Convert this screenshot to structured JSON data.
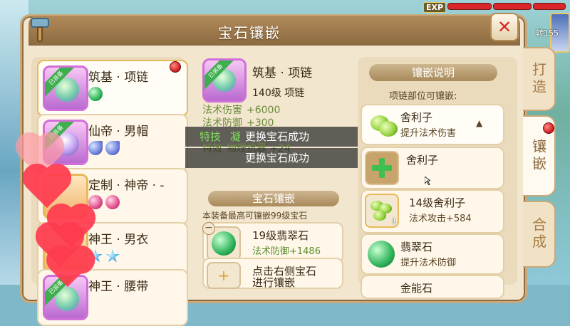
{
  "window": {
    "title": "宝石镶嵌"
  },
  "hud": {
    "exp_label": "EXP",
    "level_tag": "转155"
  },
  "tabs": [
    {
      "label": "打造"
    },
    {
      "label": "镶嵌"
    },
    {
      "label": "合成"
    }
  ],
  "equipment_list": [
    {
      "badge": "已装备",
      "name": "筑基 · 项链",
      "gems": [
        "green"
      ]
    },
    {
      "badge": "已装备",
      "name": "仙帝 · 男帽",
      "gems": [
        "moon",
        "moon"
      ]
    },
    {
      "badge": "",
      "name": "定制 · 神帝 · -",
      "gems": [
        "pink",
        "pink"
      ]
    },
    {
      "badge": "",
      "name": "神王 · 男衣",
      "gems": [
        "blue",
        "blue"
      ]
    },
    {
      "badge": "已装备",
      "name": "神王 · 腰带",
      "gems": []
    }
  ],
  "selected_item": {
    "badge": "已装备",
    "name": "筑基 · 项链",
    "level_line": "140级 项链",
    "attrs": [
      {
        "name": "法术伤害",
        "value": "+6000"
      },
      {
        "name": "法术防御",
        "value": "+300"
      },
      {
        "name": "特技",
        "value": "凝"
      },
      {
        "name": "特效",
        "value": "物理抗暴 +24"
      }
    ]
  },
  "toasts": [
    "更换宝石成功",
    "更换宝石成功"
  ],
  "socket_section": {
    "header": "宝石镶嵌",
    "note": "本装备最高可镶嵌99级宝石",
    "slots": [
      {
        "name": "19级翡翠石",
        "attr": "法术防御+1486"
      },
      {
        "name": "点击右侧宝石",
        "attr": "进行镶嵌"
      }
    ]
  },
  "inlay_info": {
    "header": "镶嵌说明",
    "note": "项链部位可镶嵌:",
    "gems": [
      {
        "name": "舍利子",
        "desc": "提升法术伤害"
      },
      {
        "name": "舍利子",
        "desc": ""
      },
      {
        "name": "14级舍利子",
        "desc": "法术攻击+584",
        "count": "1"
      },
      {
        "name": "翡翠石",
        "desc": "提升法术防御"
      },
      {
        "name": "金能石",
        "desc": ""
      }
    ]
  }
}
